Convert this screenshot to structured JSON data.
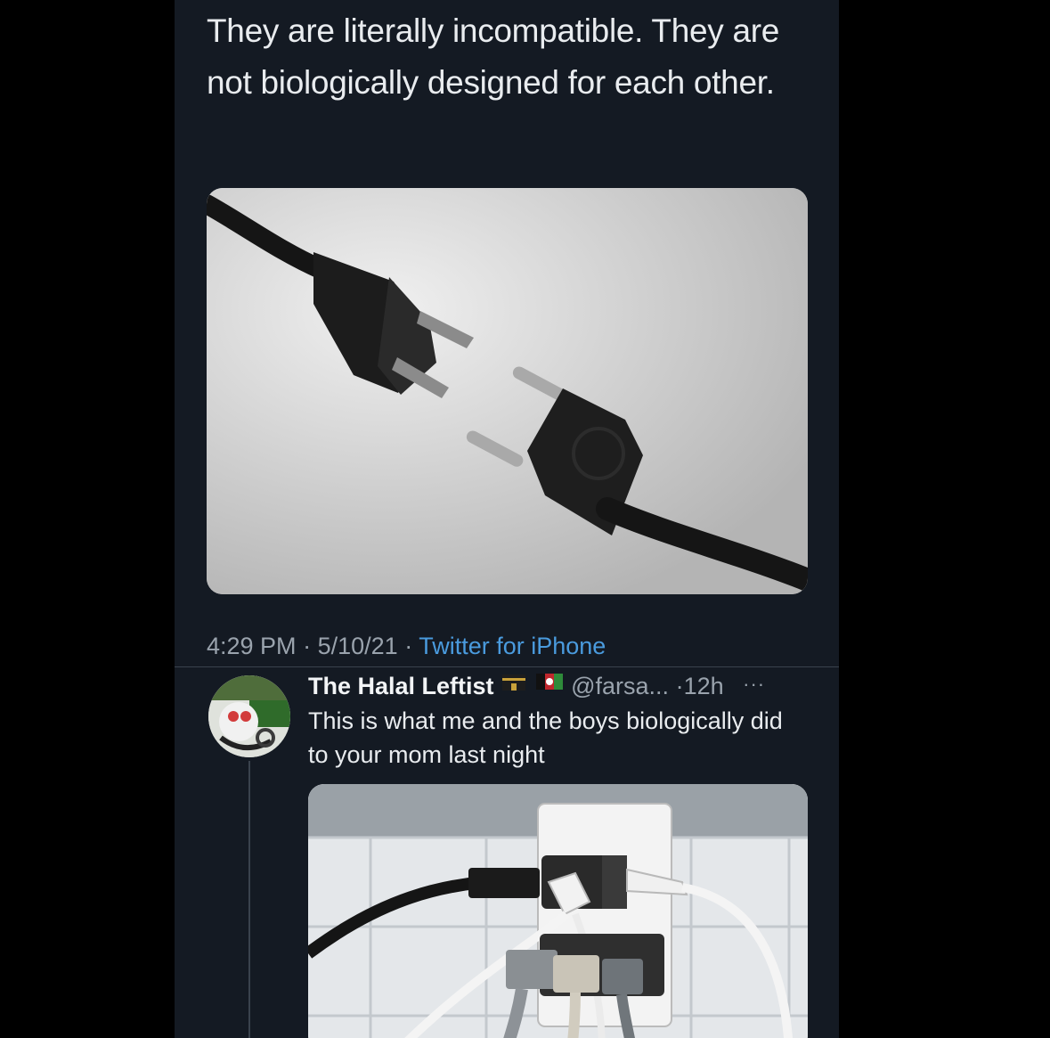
{
  "tweet": {
    "text": "They are literally incompatible. They are not biologically designed for each other.",
    "image_alt": "Two incompatible electrical plugs facing each other",
    "time": "4:29 PM",
    "date": "5/10/21",
    "separator": "·",
    "client": "Twitter for iPhone"
  },
  "reply": {
    "display_name": "The Halal Leftist",
    "handle": "@farsa...",
    "separator": "·",
    "age": "12h",
    "more": "···",
    "text": "This is what me and the boys biologically did to your mom last night",
    "image_alt": "Wall outlet with many plugs stacked into it"
  },
  "colors": {
    "background": "#141a23",
    "text": "#e9ecef",
    "muted": "#9aa3ad",
    "link": "#4a9bde"
  }
}
